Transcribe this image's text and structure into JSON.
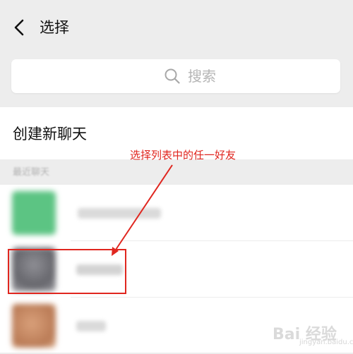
{
  "header": {
    "title": "选择",
    "back_icon": "chevron-left-icon"
  },
  "search": {
    "placeholder": "搜索",
    "icon": "search-icon"
  },
  "new_chat": {
    "label": "创建新聊天"
  },
  "recent_section": {
    "label": "最近聊天"
  },
  "contacts": [
    {
      "avatar_color": "#5cc483",
      "name_blurred": true
    },
    {
      "avatar_color": "#707077",
      "name_blurred": true
    },
    {
      "avatar_color": "#c98a62",
      "name_blurred": true
    }
  ],
  "annotation": {
    "text": "选择列表中的任一好友",
    "color": "#e0261f"
  },
  "watermark": {
    "text": "Bai 经验",
    "sub": "jingyan.baidu.com"
  },
  "colors": {
    "background": "#ededed",
    "surface": "#ffffff",
    "primary_text": "#111111",
    "muted_text": "#b2b2b2"
  }
}
